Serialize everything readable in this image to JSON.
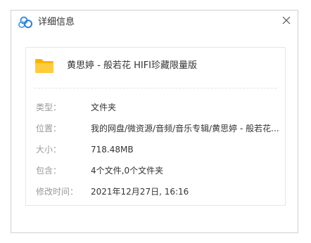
{
  "window": {
    "title": "详细信息",
    "close_glyph": "✕"
  },
  "file": {
    "name": "黄思婷 - 般若花 HIFI珍藏限量版",
    "icon": "folder-icon",
    "icon_color": "#ffc83d"
  },
  "details": [
    {
      "label": "类型：",
      "value": "文件夹"
    },
    {
      "label": "位置：",
      "value": "我的网盘/微资源/音频/音乐专辑/黄思婷 - 般若花..."
    },
    {
      "label": "大小：",
      "value": "718.48MB"
    },
    {
      "label": "包含：",
      "value": "4个文件,0个文件夹"
    },
    {
      "label": "修改时间：",
      "value": "2021年12月27日, 16:16"
    }
  ],
  "colors": {
    "label_gray": "#999999",
    "text": "#333333",
    "border": "#cfcfcf",
    "logo_blue": "#3b8fe0"
  }
}
